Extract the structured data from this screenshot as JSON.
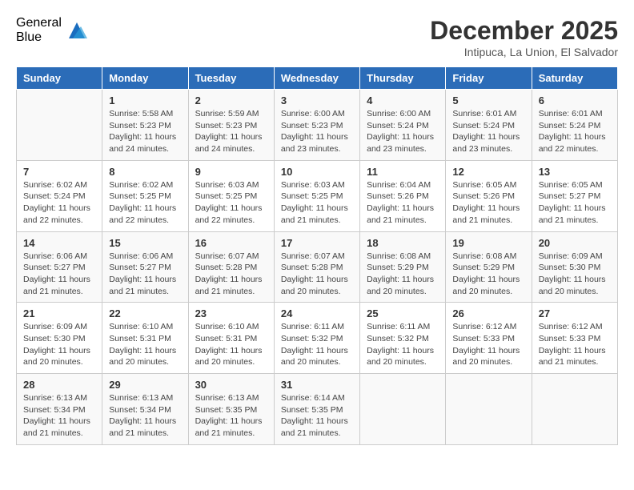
{
  "logo": {
    "general": "General",
    "blue": "Blue"
  },
  "header": {
    "month": "December 2025",
    "location": "Intipuca, La Union, El Salvador"
  },
  "days_of_week": [
    "Sunday",
    "Monday",
    "Tuesday",
    "Wednesday",
    "Thursday",
    "Friday",
    "Saturday"
  ],
  "weeks": [
    [
      {
        "day": "",
        "info": ""
      },
      {
        "day": "1",
        "info": "Sunrise: 5:58 AM\nSunset: 5:23 PM\nDaylight: 11 hours and 24 minutes."
      },
      {
        "day": "2",
        "info": "Sunrise: 5:59 AM\nSunset: 5:23 PM\nDaylight: 11 hours and 24 minutes."
      },
      {
        "day": "3",
        "info": "Sunrise: 6:00 AM\nSunset: 5:23 PM\nDaylight: 11 hours and 23 minutes."
      },
      {
        "day": "4",
        "info": "Sunrise: 6:00 AM\nSunset: 5:24 PM\nDaylight: 11 hours and 23 minutes."
      },
      {
        "day": "5",
        "info": "Sunrise: 6:01 AM\nSunset: 5:24 PM\nDaylight: 11 hours and 23 minutes."
      },
      {
        "day": "6",
        "info": "Sunrise: 6:01 AM\nSunset: 5:24 PM\nDaylight: 11 hours and 22 minutes."
      }
    ],
    [
      {
        "day": "7",
        "info": "Sunrise: 6:02 AM\nSunset: 5:24 PM\nDaylight: 11 hours and 22 minutes."
      },
      {
        "day": "8",
        "info": "Sunrise: 6:02 AM\nSunset: 5:25 PM\nDaylight: 11 hours and 22 minutes."
      },
      {
        "day": "9",
        "info": "Sunrise: 6:03 AM\nSunset: 5:25 PM\nDaylight: 11 hours and 22 minutes."
      },
      {
        "day": "10",
        "info": "Sunrise: 6:03 AM\nSunset: 5:25 PM\nDaylight: 11 hours and 21 minutes."
      },
      {
        "day": "11",
        "info": "Sunrise: 6:04 AM\nSunset: 5:26 PM\nDaylight: 11 hours and 21 minutes."
      },
      {
        "day": "12",
        "info": "Sunrise: 6:05 AM\nSunset: 5:26 PM\nDaylight: 11 hours and 21 minutes."
      },
      {
        "day": "13",
        "info": "Sunrise: 6:05 AM\nSunset: 5:27 PM\nDaylight: 11 hours and 21 minutes."
      }
    ],
    [
      {
        "day": "14",
        "info": "Sunrise: 6:06 AM\nSunset: 5:27 PM\nDaylight: 11 hours and 21 minutes."
      },
      {
        "day": "15",
        "info": "Sunrise: 6:06 AM\nSunset: 5:27 PM\nDaylight: 11 hours and 21 minutes."
      },
      {
        "day": "16",
        "info": "Sunrise: 6:07 AM\nSunset: 5:28 PM\nDaylight: 11 hours and 21 minutes."
      },
      {
        "day": "17",
        "info": "Sunrise: 6:07 AM\nSunset: 5:28 PM\nDaylight: 11 hours and 20 minutes."
      },
      {
        "day": "18",
        "info": "Sunrise: 6:08 AM\nSunset: 5:29 PM\nDaylight: 11 hours and 20 minutes."
      },
      {
        "day": "19",
        "info": "Sunrise: 6:08 AM\nSunset: 5:29 PM\nDaylight: 11 hours and 20 minutes."
      },
      {
        "day": "20",
        "info": "Sunrise: 6:09 AM\nSunset: 5:30 PM\nDaylight: 11 hours and 20 minutes."
      }
    ],
    [
      {
        "day": "21",
        "info": "Sunrise: 6:09 AM\nSunset: 5:30 PM\nDaylight: 11 hours and 20 minutes."
      },
      {
        "day": "22",
        "info": "Sunrise: 6:10 AM\nSunset: 5:31 PM\nDaylight: 11 hours and 20 minutes."
      },
      {
        "day": "23",
        "info": "Sunrise: 6:10 AM\nSunset: 5:31 PM\nDaylight: 11 hours and 20 minutes."
      },
      {
        "day": "24",
        "info": "Sunrise: 6:11 AM\nSunset: 5:32 PM\nDaylight: 11 hours and 20 minutes."
      },
      {
        "day": "25",
        "info": "Sunrise: 6:11 AM\nSunset: 5:32 PM\nDaylight: 11 hours and 20 minutes."
      },
      {
        "day": "26",
        "info": "Sunrise: 6:12 AM\nSunset: 5:33 PM\nDaylight: 11 hours and 20 minutes."
      },
      {
        "day": "27",
        "info": "Sunrise: 6:12 AM\nSunset: 5:33 PM\nDaylight: 11 hours and 21 minutes."
      }
    ],
    [
      {
        "day": "28",
        "info": "Sunrise: 6:13 AM\nSunset: 5:34 PM\nDaylight: 11 hours and 21 minutes."
      },
      {
        "day": "29",
        "info": "Sunrise: 6:13 AM\nSunset: 5:34 PM\nDaylight: 11 hours and 21 minutes."
      },
      {
        "day": "30",
        "info": "Sunrise: 6:13 AM\nSunset: 5:35 PM\nDaylight: 11 hours and 21 minutes."
      },
      {
        "day": "31",
        "info": "Sunrise: 6:14 AM\nSunset: 5:35 PM\nDaylight: 11 hours and 21 minutes."
      },
      {
        "day": "",
        "info": ""
      },
      {
        "day": "",
        "info": ""
      },
      {
        "day": "",
        "info": ""
      }
    ]
  ]
}
